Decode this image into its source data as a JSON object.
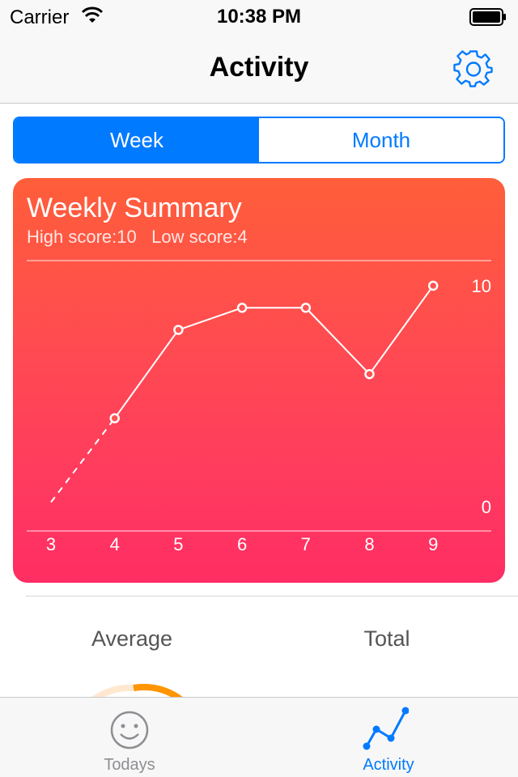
{
  "status_bar": {
    "carrier": "Carrier",
    "time": "10:38 PM"
  },
  "nav": {
    "title": "Activity"
  },
  "segmented": {
    "options": [
      "Week",
      "Month"
    ],
    "selected": "Week"
  },
  "card": {
    "title": "Weekly Summary",
    "high_label": "High score:10",
    "low_label": "Low score:4"
  },
  "chart_data": {
    "type": "line",
    "x": [
      4,
      5,
      6,
      7,
      8,
      9
    ],
    "categories": [
      "3",
      "4",
      "5",
      "6",
      "7",
      "8",
      "9"
    ],
    "values": [
      4,
      8,
      9,
      9,
      6,
      10
    ],
    "dashed_lead_in": {
      "x": 3,
      "y": 0.2
    },
    "ylim": [
      0,
      10
    ],
    "y_ticks": [
      "10",
      "0"
    ],
    "line_color": "#ffffff"
  },
  "stats": {
    "average_label": "Average",
    "total_label": "Total"
  },
  "tabbar": {
    "tabs": [
      {
        "label": "Todays",
        "icon": "smiley-icon",
        "active": false
      },
      {
        "label": "Activity",
        "icon": "line-chart-icon",
        "active": true
      }
    ]
  },
  "colors": {
    "accent": "#007aff",
    "card_top": "#ff5e3a",
    "card_bottom": "#ff2d63",
    "gauge": "#ff9500"
  }
}
